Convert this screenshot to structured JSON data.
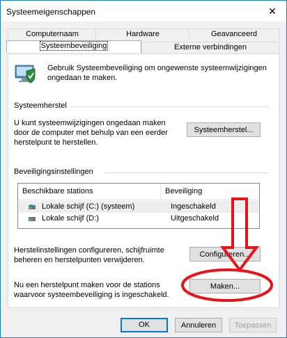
{
  "window": {
    "title": "Systeemeigenschappen",
    "close_glyph": "✕"
  },
  "tabs": [
    {
      "label": "Computernaam",
      "active": false
    },
    {
      "label": "Hardware",
      "active": false
    },
    {
      "label": "Geavanceerd",
      "active": false
    },
    {
      "label": "Systeembeveiliging",
      "active": true
    },
    {
      "label": "Externe verbindingen",
      "active": false
    }
  ],
  "intro": {
    "text": "Gebruik Systeembeveiliging om ongewenste systeemwijzigingen ongedaan te maken.",
    "icon": "system-protection-icon"
  },
  "restore": {
    "group_title": "Systeemherstel",
    "text": "U kunt systeemwijzigingen ongedaan maken door de computer met behulp van een eerder herstelpunt te herstellen.",
    "button": "Systeemherstel..."
  },
  "protection": {
    "group_title": "Beveiligingsinstellingen",
    "columns": [
      "Beschikbare stations",
      "Beveiliging"
    ],
    "rows": [
      {
        "name": "Lokale schijf (C:) (systeem)",
        "status": "Ingeschakeld",
        "selected": true,
        "icon": "system-drive-icon"
      },
      {
        "name": "Lokale schijf (D:)",
        "status": "Uitgeschakeld",
        "selected": false,
        "icon": "drive-icon"
      }
    ],
    "configure_text": "Herstelinstellingen configureren, schijfruimte beheren en herstelpunten verwijderen.",
    "configure_button": "Configureren...",
    "create_text": "Nu een herstelpunt maken voor de stations waarvoor systeembeveiliging is ingeschakeld.",
    "create_button": "Maken..."
  },
  "footer": {
    "ok": "OK",
    "cancel": "Annuleren",
    "apply": "Toepassen"
  },
  "annotation": {
    "color": "#e8141c",
    "shape": "down-arrow-and-ellipse"
  },
  "colors": {
    "window_border": "#1979ca",
    "focus_border": "#0078d7"
  }
}
